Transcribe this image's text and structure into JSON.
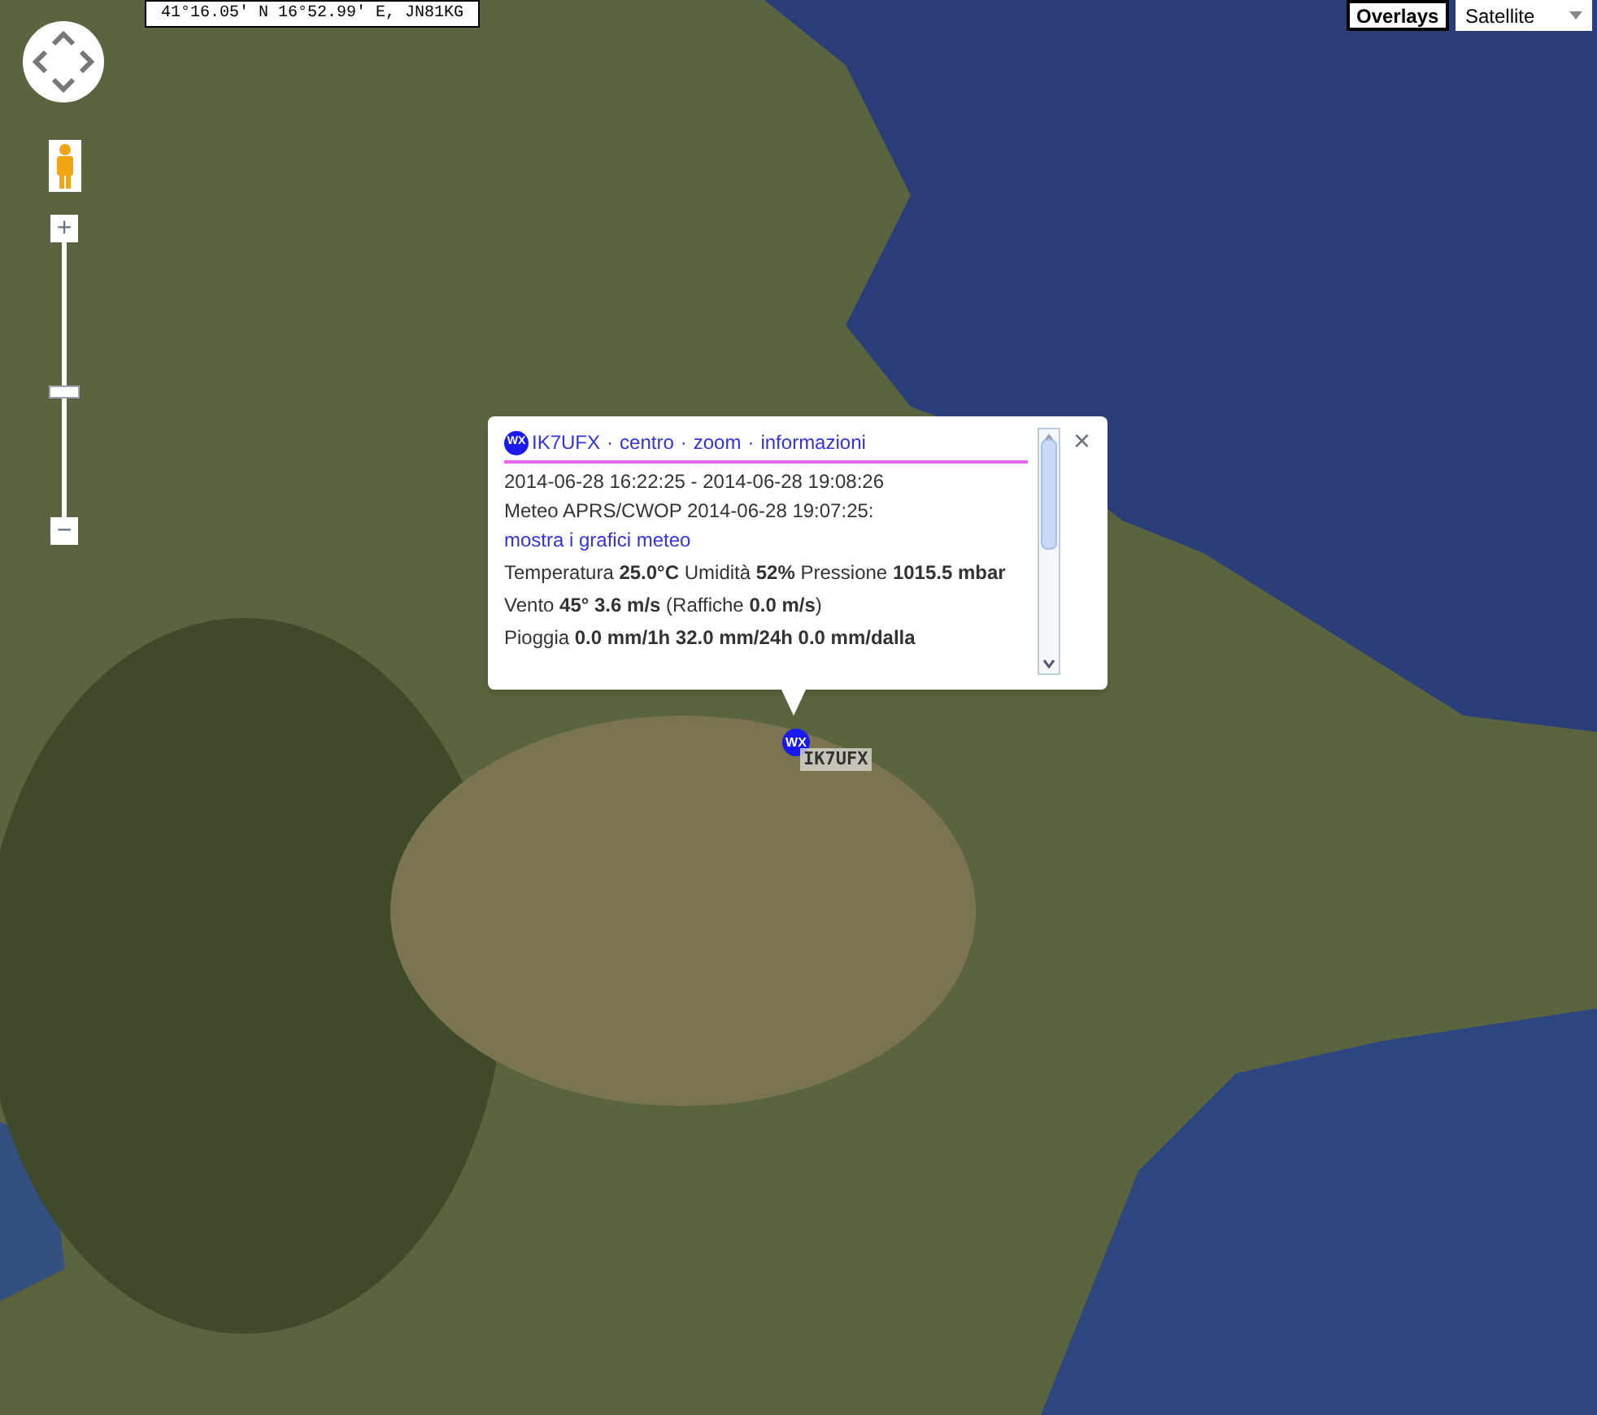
{
  "coordinates": "41°16.05' N 16°52.99' E, JN81KG",
  "map_type": {
    "overlays_button": "Overlays",
    "select": "Satellite"
  },
  "zoom": {
    "plus": "+",
    "minus": "−",
    "level": 0.46
  },
  "popup": {
    "icon_text": "WX",
    "links": [
      "IK7UFX",
      "centro",
      "zoom",
      "informazioni"
    ],
    "separator": "·",
    "close": "×",
    "period": "2014-06-28 16:22:25 - 2014-06-28 19:08:26",
    "meteo": {
      "text": "Meteo APRS/CWOP 2014-06-28 19:07:25:",
      "link": "mostra i grafici meteo"
    },
    "lines": [
      "Temperatura **25.0°C** Umidità **52%** Pressione **1015.5 mbar**",
      "Vento **45° 3.6 m/s** (Raffiche **0.0 m/s**)",
      "Pioggia **0.0 mm/1h 32.0 mm/24h 0.0 mm/dalla**"
    ]
  },
  "marker": {
    "icon_text": "WX",
    "label": "IK7UFX"
  }
}
